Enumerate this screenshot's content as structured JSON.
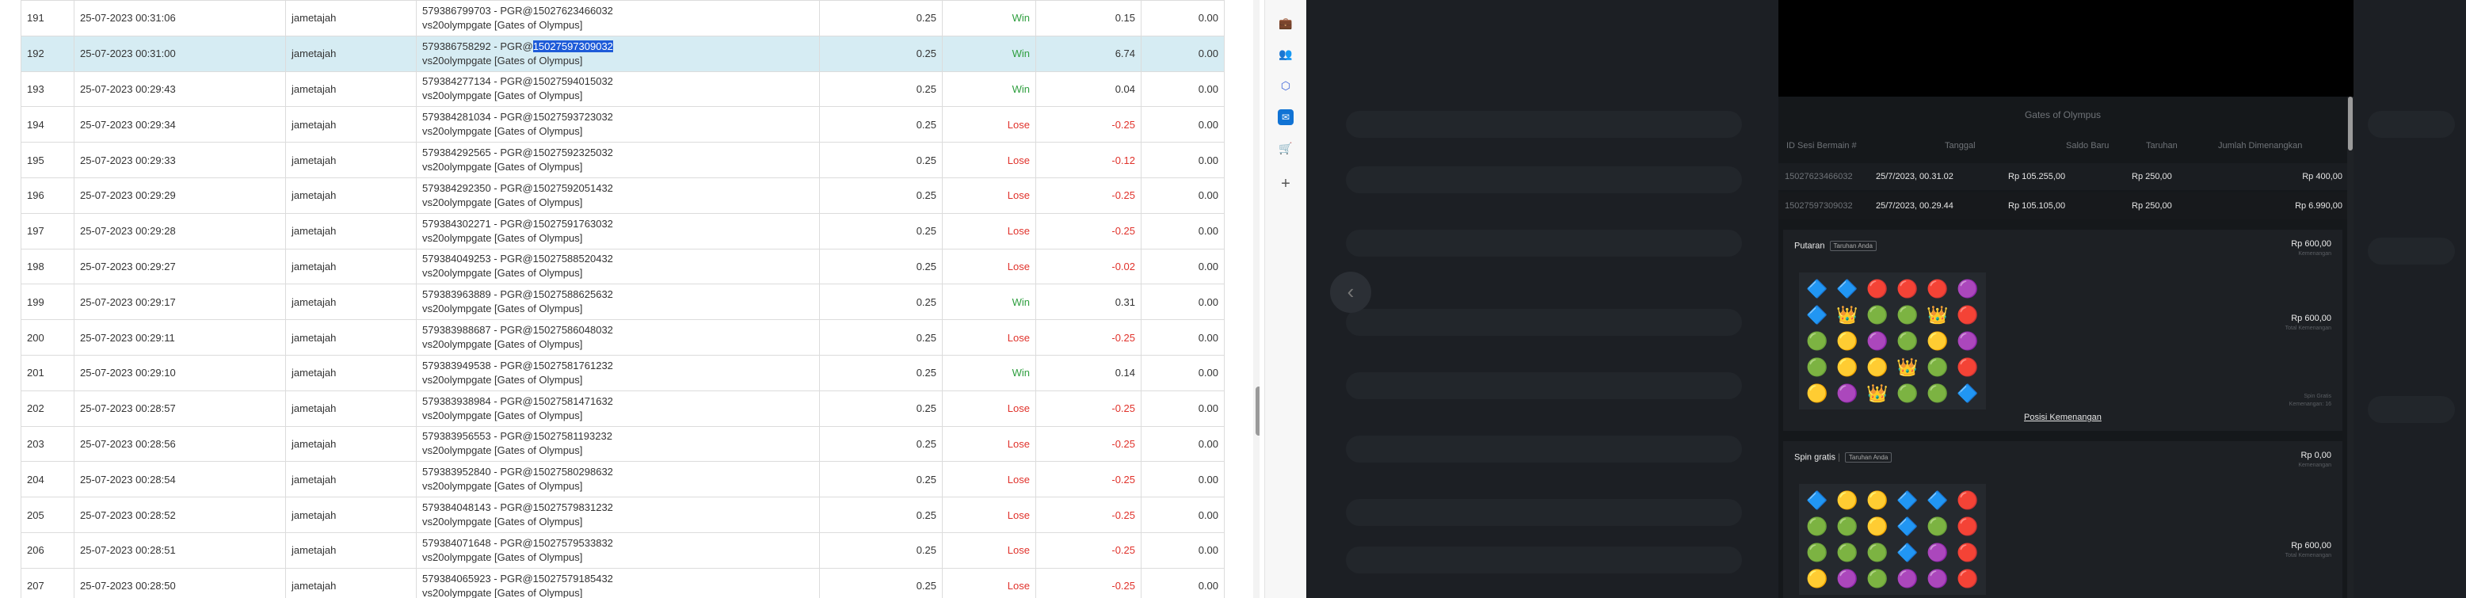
{
  "table": {
    "rows": [
      {
        "no": "191",
        "date": "25-07-2023 00:31:06",
        "user": "jametajah",
        "game_id": "579386799703 - PGR@15027623466032",
        "game_name": "vs20olympgate [Gates of Olympus]",
        "bet": "0.25",
        "status": "Win",
        "win": "0.15",
        "jp": "0.00"
      },
      {
        "no": "192",
        "date": "25-07-2023 00:31:00",
        "user": "jametajah",
        "game_id_prefix": "579386758292 - PGR@",
        "game_id_highlight": "15027597309032",
        "game_name": "vs20olympgate [Gates of Olympus]",
        "bet": "0.25",
        "status": "Win",
        "win": "6.74",
        "jp": "0.00",
        "selected": true
      },
      {
        "no": "193",
        "date": "25-07-2023 00:29:43",
        "user": "jametajah",
        "game_id": "579384277134 - PGR@15027594015032",
        "game_name": "vs20olympgate [Gates of Olympus]",
        "bet": "0.25",
        "status": "Win",
        "win": "0.04",
        "jp": "0.00"
      },
      {
        "no": "194",
        "date": "25-07-2023 00:29:34",
        "user": "jametajah",
        "game_id": "579384281034 - PGR@15027593723032",
        "game_name": "vs20olympgate [Gates of Olympus]",
        "bet": "0.25",
        "status": "Lose",
        "win": "-0.25",
        "jp": "0.00"
      },
      {
        "no": "195",
        "date": "25-07-2023 00:29:33",
        "user": "jametajah",
        "game_id": "579384292565 - PGR@15027592325032",
        "game_name": "vs20olympgate [Gates of Olympus]",
        "bet": "0.25",
        "status": "Lose",
        "win": "-0.12",
        "jp": "0.00"
      },
      {
        "no": "196",
        "date": "25-07-2023 00:29:29",
        "user": "jametajah",
        "game_id": "579384292350 - PGR@15027592051432",
        "game_name": "vs20olympgate [Gates of Olympus]",
        "bet": "0.25",
        "status": "Lose",
        "win": "-0.25",
        "jp": "0.00"
      },
      {
        "no": "197",
        "date": "25-07-2023 00:29:28",
        "user": "jametajah",
        "game_id": "579384302271 - PGR@15027591763032",
        "game_name": "vs20olympgate [Gates of Olympus]",
        "bet": "0.25",
        "status": "Lose",
        "win": "-0.25",
        "jp": "0.00"
      },
      {
        "no": "198",
        "date": "25-07-2023 00:29:27",
        "user": "jametajah",
        "game_id": "579384049253 - PGR@15027588520432",
        "game_name": "vs20olympgate [Gates of Olympus]",
        "bet": "0.25",
        "status": "Lose",
        "win": "-0.02",
        "jp": "0.00"
      },
      {
        "no": "199",
        "date": "25-07-2023 00:29:17",
        "user": "jametajah",
        "game_id": "579383963889 - PGR@15027588625632",
        "game_name": "vs20olympgate [Gates of Olympus]",
        "bet": "0.25",
        "status": "Win",
        "win": "0.31",
        "jp": "0.00"
      },
      {
        "no": "200",
        "date": "25-07-2023 00:29:11",
        "user": "jametajah",
        "game_id": "579383988687 - PGR@15027586048032",
        "game_name": "vs20olympgate [Gates of Olympus]",
        "bet": "0.25",
        "status": "Lose",
        "win": "-0.25",
        "jp": "0.00"
      },
      {
        "no": "201",
        "date": "25-07-2023 00:29:10",
        "user": "jametajah",
        "game_id": "579383949538 - PGR@15027581761232",
        "game_name": "vs20olympgate [Gates of Olympus]",
        "bet": "0.25",
        "status": "Win",
        "win": "0.14",
        "jp": "0.00"
      },
      {
        "no": "202",
        "date": "25-07-2023 00:28:57",
        "user": "jametajah",
        "game_id": "579383938984 - PGR@15027581471632",
        "game_name": "vs20olympgate [Gates of Olympus]",
        "bet": "0.25",
        "status": "Lose",
        "win": "-0.25",
        "jp": "0.00"
      },
      {
        "no": "203",
        "date": "25-07-2023 00:28:56",
        "user": "jametajah",
        "game_id": "579383956553 - PGR@15027581193232",
        "game_name": "vs20olympgate [Gates of Olympus]",
        "bet": "0.25",
        "status": "Lose",
        "win": "-0.25",
        "jp": "0.00"
      },
      {
        "no": "204",
        "date": "25-07-2023 00:28:54",
        "user": "jametajah",
        "game_id": "579383952840 - PGR@15027580298632",
        "game_name": "vs20olympgate [Gates of Olympus]",
        "bet": "0.25",
        "status": "Lose",
        "win": "-0.25",
        "jp": "0.00"
      },
      {
        "no": "205",
        "date": "25-07-2023 00:28:52",
        "user": "jametajah",
        "game_id": "579384048143 - PGR@15027579831232",
        "game_name": "vs20olympgate [Gates of Olympus]",
        "bet": "0.25",
        "status": "Lose",
        "win": "-0.25",
        "jp": "0.00"
      },
      {
        "no": "206",
        "date": "25-07-2023 00:28:51",
        "user": "jametajah",
        "game_id": "579384071648 - PGR@15027579533832",
        "game_name": "vs20olympgate [Gates of Olympus]",
        "bet": "0.25",
        "status": "Lose",
        "win": "-0.25",
        "jp": "0.00"
      },
      {
        "no": "207",
        "date": "25-07-2023 00:28:50",
        "user": "jametajah",
        "game_id": "579384065923 - PGR@15027579185432",
        "game_name": "vs20olympgate [Gates of Olympus]",
        "bet": "0.25",
        "status": "Lose",
        "win": "-0.25",
        "jp": "0.00"
      }
    ]
  },
  "colors": {
    "win": "#2e9e3e",
    "lose": "#e0322b",
    "selected_row": "#d6ecf3",
    "highlight": "#1e5bd8"
  },
  "sidebar": {
    "icons": [
      {
        "name": "briefcase-icon",
        "glyph": "💼"
      },
      {
        "name": "people-icon",
        "glyph": "👥"
      },
      {
        "name": "copilot-icon",
        "glyph": "⬡"
      },
      {
        "name": "outlook-icon",
        "glyph": "✉"
      },
      {
        "name": "shopping-icon",
        "glyph": "🛒"
      },
      {
        "name": "add-icon",
        "glyph": "+"
      }
    ]
  },
  "modal": {
    "title": "Gates of Olympus",
    "headers": {
      "id": "ID Sesi Bermain #",
      "date": "Tanggal",
      "balance": "Saldo Baru",
      "bet": "Taruhan",
      "win": "Jumlah Dimenangkan"
    },
    "rows": [
      {
        "id": "15027623466032",
        "date": "25/7/2023, 00.31.02",
        "balance": "Rp 105.255,00",
        "bet": "Rp 250,00",
        "win": "Rp 400,00"
      },
      {
        "id": "15027597309032",
        "date": "25/7/2023, 00.29.44",
        "balance": "Rp 105.105,00",
        "bet": "Rp 250,00",
        "win": "Rp 6.990,00"
      }
    ],
    "putaran": {
      "title": "Putaran",
      "tag": "Taruhan Anda",
      "amount": "Rp 600,00",
      "amount_sub": "Kemenangan",
      "grid_amount": "Rp 600,00",
      "grid_amount_sub": "Total Kemenangan",
      "note1": "Spin Gratis",
      "note2": "Kemenangan: 16",
      "link": "Posisi Kemenangan"
    },
    "spin_gratis": {
      "title": "Spin gratis",
      "sep": "|",
      "tag": "Taruhan Anda",
      "amount": "Rp 0,00",
      "amount_sub": "Kemenangan",
      "grid_amount": "Rp 600,00",
      "grid_amount_sub": "Total Kemenangan"
    },
    "grid1": [
      [
        "🔷",
        "🔷",
        "🔴",
        "🔴",
        "🔴",
        "🟣"
      ],
      [
        "🔷",
        "👑",
        "🟢",
        "🟢",
        "👑",
        "🔴"
      ],
      [
        "🟢",
        "🟡",
        "🟣",
        "🟢",
        "🟡",
        "🟣"
      ],
      [
        "🟢",
        "🟡",
        "🟡",
        "👑",
        "🟢",
        "🔴"
      ],
      [
        "🟡",
        "🟣",
        "👑",
        "🟢",
        "🟢",
        "🔷"
      ]
    ],
    "grid2": [
      [
        "🔷",
        "🟡",
        "🟡",
        "🔷",
        "🔷",
        "🔴"
      ],
      [
        "🟢",
        "🟢",
        "🟡",
        "🔷",
        "🟢",
        "🔴"
      ],
      [
        "🟢",
        "🟢",
        "🟢",
        "🔷",
        "🟣",
        "🔴"
      ],
      [
        "🟡",
        "🟣",
        "🟢",
        "🟣",
        "🟣",
        "🔴"
      ]
    ]
  }
}
